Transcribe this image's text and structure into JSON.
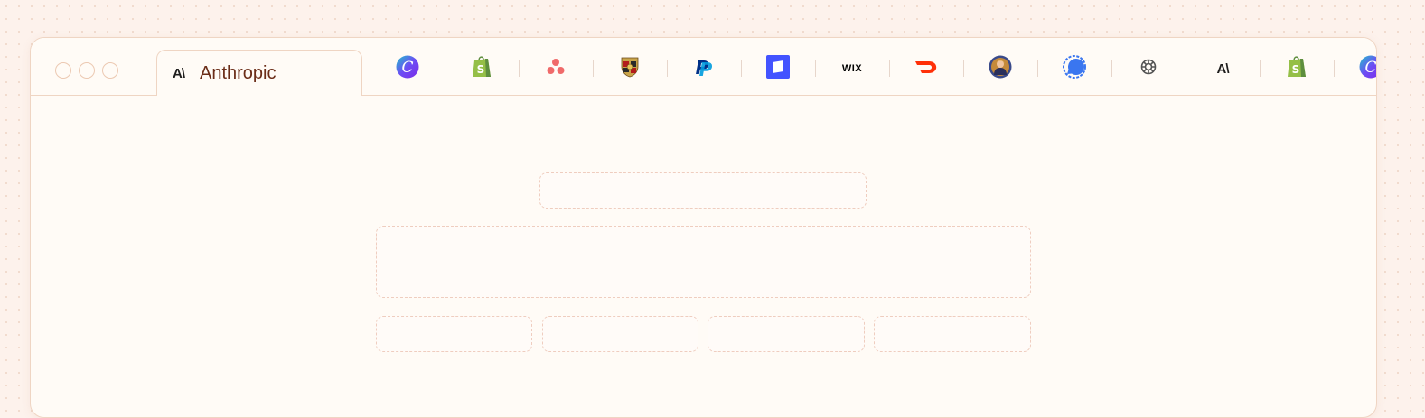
{
  "window": {
    "traffic_lights": [
      "close",
      "minimize",
      "zoom"
    ],
    "active_tab": {
      "logo_text": "A\\",
      "title": "Anthropic",
      "icon": "anthropic-logo"
    }
  },
  "tab_strip": [
    {
      "name": "canva",
      "icon": "canva-logo"
    },
    {
      "name": "shopify",
      "icon": "shopify-logo"
    },
    {
      "name": "asana",
      "icon": "asana-logo"
    },
    {
      "name": "porsche",
      "icon": "porsche-crest"
    },
    {
      "name": "paypal",
      "icon": "paypal-logo"
    },
    {
      "name": "webflow",
      "icon": "webflow-logo"
    },
    {
      "name": "wix",
      "icon": "wix-logo",
      "text": "WIX"
    },
    {
      "name": "doordash",
      "icon": "doordash-logo"
    },
    {
      "name": "avatar",
      "icon": "portrait-avatar"
    },
    {
      "name": "signal",
      "icon": "signal-logo"
    },
    {
      "name": "openai",
      "icon": "openai-logo"
    },
    {
      "name": "anthropic",
      "icon": "anthropic-logo",
      "text": "A\\"
    },
    {
      "name": "shopify",
      "icon": "shopify-logo"
    },
    {
      "name": "canva",
      "icon": "canva-logo"
    }
  ],
  "colors": {
    "background": "#fdf2ec",
    "window_bg": "#fffbf6",
    "border": "#efd5c3",
    "tab_title": "#6b2d18",
    "placeholder_border": "#efcdbf"
  },
  "content": {
    "placeholders": [
      "title",
      "hero",
      "card-1",
      "card-2",
      "card-3",
      "card-4"
    ]
  }
}
